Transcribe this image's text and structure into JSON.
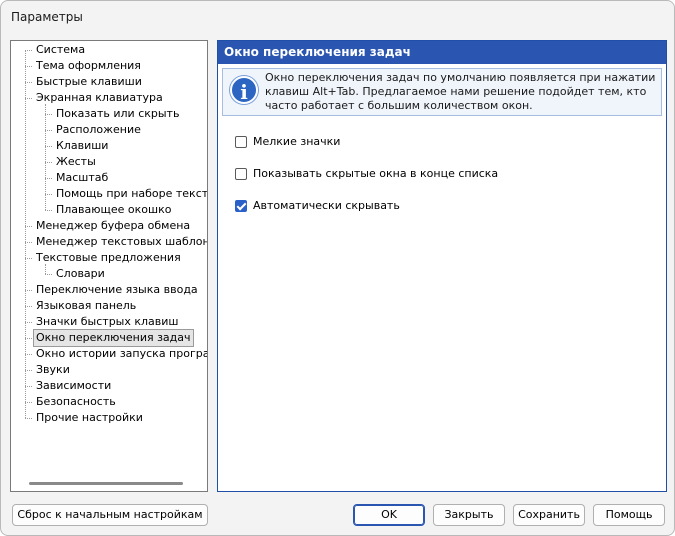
{
  "window": {
    "title": "Параметры"
  },
  "tree": {
    "items": [
      "Система",
      "Тема оформления",
      "Быстрые клавиши",
      "Экранная клавиатура",
      "Показать или скрыть",
      "Расположение",
      "Клавиши",
      "Жесты",
      "Масштаб",
      "Помощь при наборе текста",
      "Плавающее окошко",
      "Менеджер буфера обмена",
      "Менеджер текстовых шаблонов",
      "Текстовые предложения",
      "Словари",
      "Переключение языка ввода",
      "Языковая панель",
      "Значки быстрых клавиш",
      "Окно переключения задач",
      "Окно истории запуска программ",
      "Звуки",
      "Зависимости",
      "Безопасность",
      "Прочие настройки"
    ],
    "selected": "Окно переключения задач"
  },
  "panel": {
    "title": "Окно переключения задач",
    "info_text": "Окно переключения задач по умолчанию появляется при нажатии клавиш Alt+Tab. Предлагаемое нами решение подойдет тем, кто часто работает с большим количеством окон.",
    "options": [
      {
        "label": "Мелкие значки",
        "checked": false
      },
      {
        "label": "Показывать скрытые окна в конце списка",
        "checked": false
      },
      {
        "label": "Автоматически скрывать",
        "checked": true
      }
    ]
  },
  "buttons": {
    "reset": "Сброс к начальным настройкам",
    "ok": "OK",
    "close": "Закрыть",
    "save": "Сохранить",
    "help": "Помощь"
  },
  "colors": {
    "accent": "#2a55b0",
    "checkbox_checked": "#2a61c8"
  },
  "icons": {
    "info": "info-icon"
  }
}
